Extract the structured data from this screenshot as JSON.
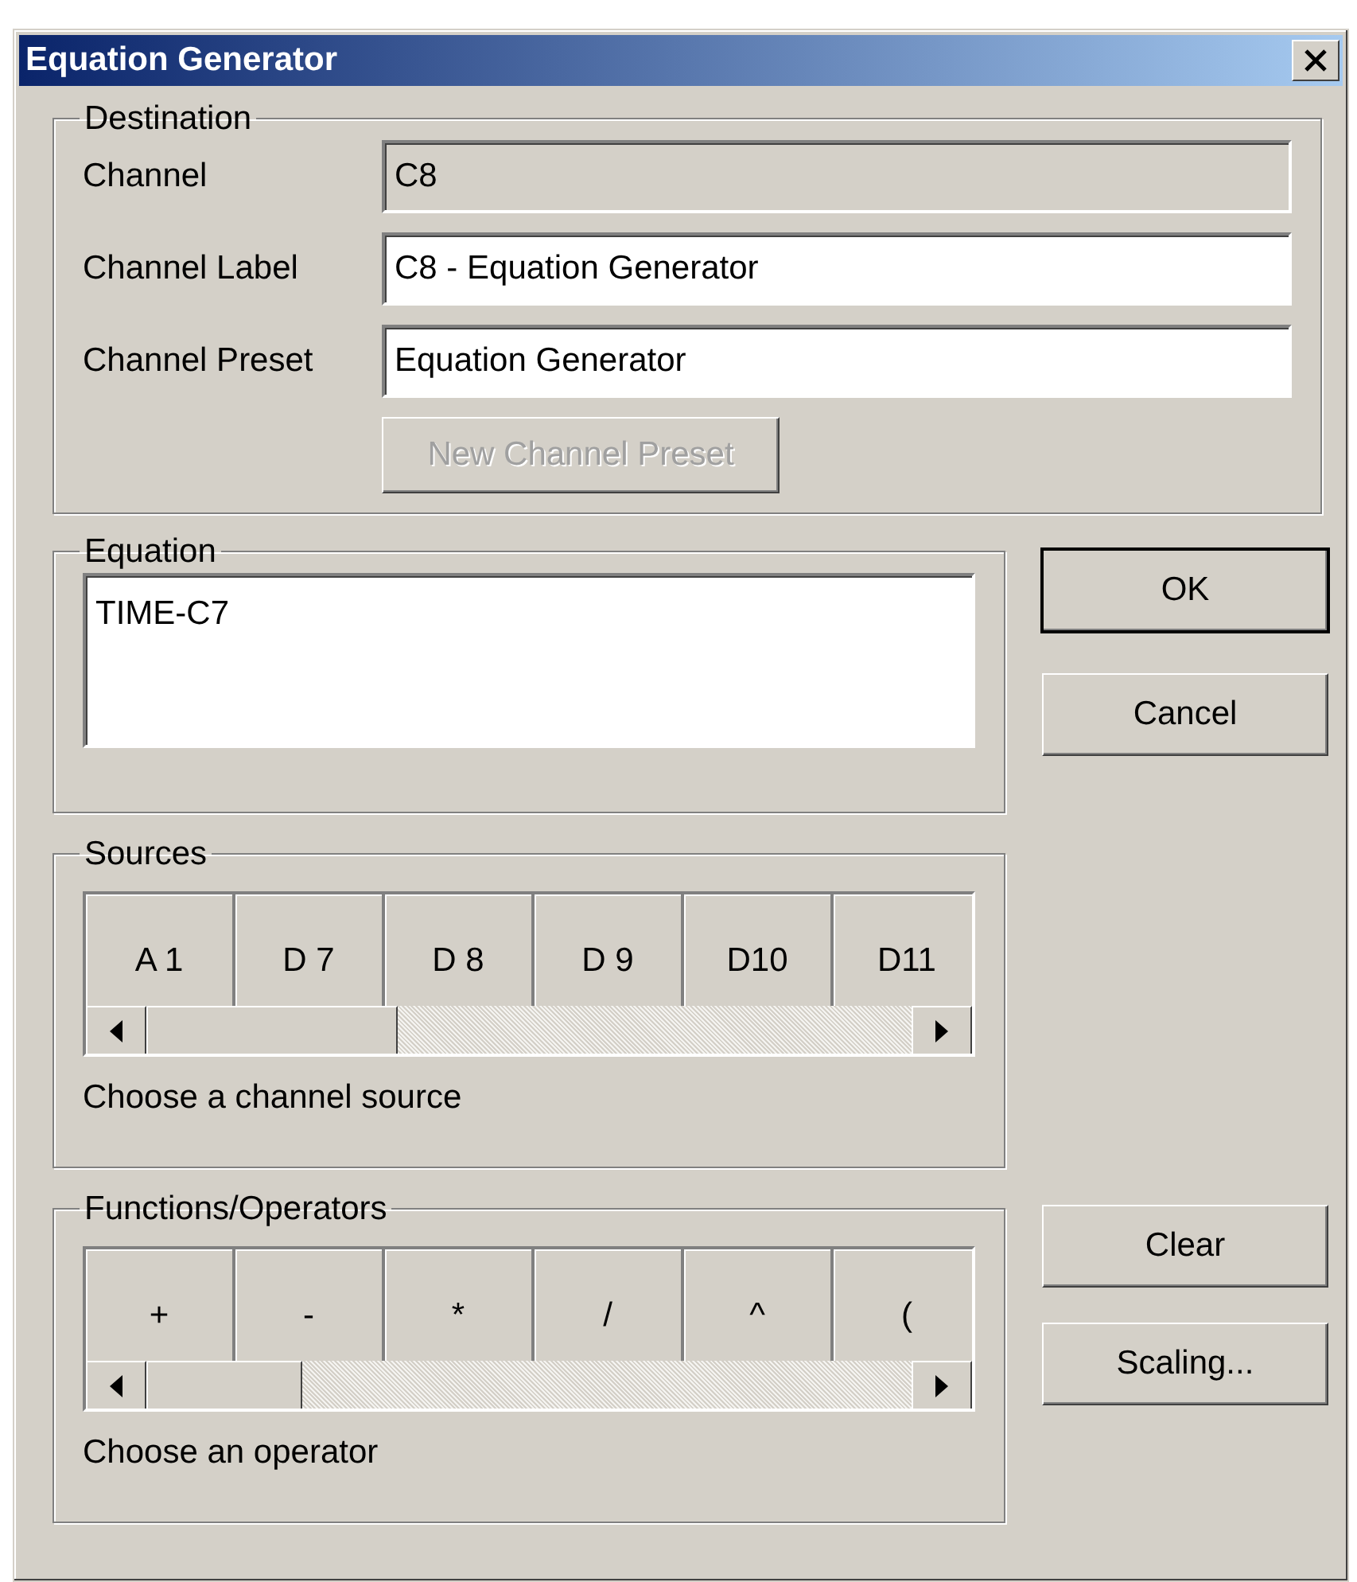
{
  "window": {
    "title": "Equation Generator"
  },
  "destination": {
    "title": "Destination",
    "fields": [
      {
        "label": "Channel",
        "value": "C8",
        "disabled": true
      },
      {
        "label": "Channel Label",
        "value": "C8 - Equation Generator",
        "disabled": false
      },
      {
        "label": "Channel Preset",
        "value": "Equation Generator",
        "disabled": false
      }
    ],
    "preset_button": {
      "label": "New Channel Preset",
      "disabled": true
    }
  },
  "equation": {
    "title": "Equation",
    "value": "TIME-C7"
  },
  "sources": {
    "title": "Sources",
    "items": [
      "A 1",
      "D 7",
      "D 8",
      "D 9",
      "D10",
      "D11"
    ],
    "hint": "Choose a channel source"
  },
  "operators": {
    "title": "Functions/Operators",
    "items": [
      "+",
      "-",
      "*",
      "/",
      "^",
      "("
    ],
    "hint": "Choose an operator"
  },
  "buttons": [
    {
      "label": "OK",
      "default": true
    },
    {
      "label": "Cancel",
      "default": false
    },
    {
      "label": "Clear",
      "default": false
    },
    {
      "label": "Scaling...",
      "default": false
    }
  ]
}
